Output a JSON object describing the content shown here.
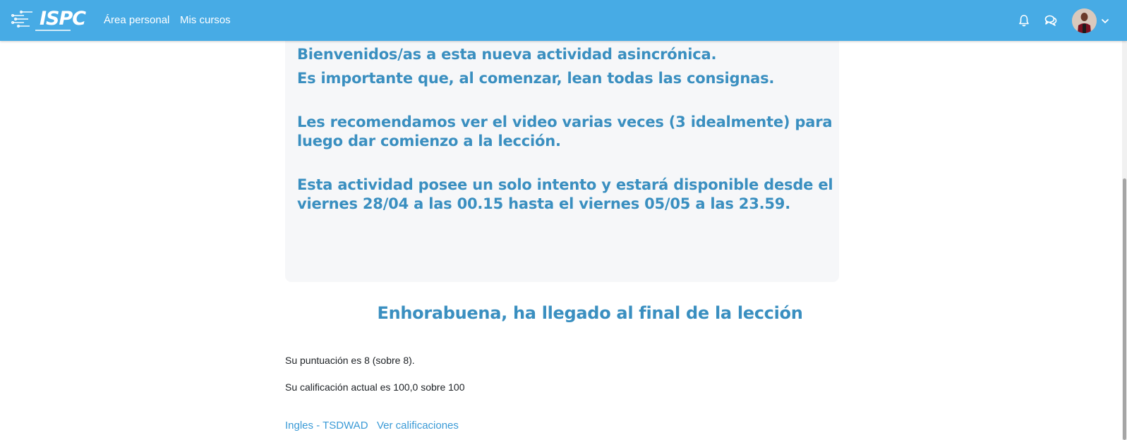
{
  "navbar": {
    "logo_text": "ISPC",
    "links": [
      {
        "label": "Área personal"
      },
      {
        "label": "Mis cursos"
      }
    ],
    "icons": {
      "notifications": "bell-icon",
      "messages": "chat-bubbles-icon",
      "user_menu": "chevron-down-icon"
    },
    "accent_color": "#47abe5"
  },
  "lesson": {
    "line1": "Bienvenidos/as a esta nueva actividad asincrónica.",
    "line2": "Es importante que, al comenzar, lean todas las consignas.",
    "paragraph3": "Les recomendamos ver el video varias veces (3 idealmente) para luego dar comienzo a la lección.",
    "paragraph4": "Esta actividad posee un solo intento y estará disponible desde el viernes 28/04 a las 00.15 hasta el viernes 05/05 a las 23.59.",
    "text_color": "#3a8fc0"
  },
  "result": {
    "heading": "Enhorabuena, ha llegado al final de la lección",
    "score_text": "Su puntuación es 8 (sobre 8).",
    "grade_text": "Su calificación actual es 100,0 sobre 100"
  },
  "footer_links": [
    {
      "label": "Ingles - TSDWAD"
    },
    {
      "label": "Ver calificaciones"
    }
  ]
}
